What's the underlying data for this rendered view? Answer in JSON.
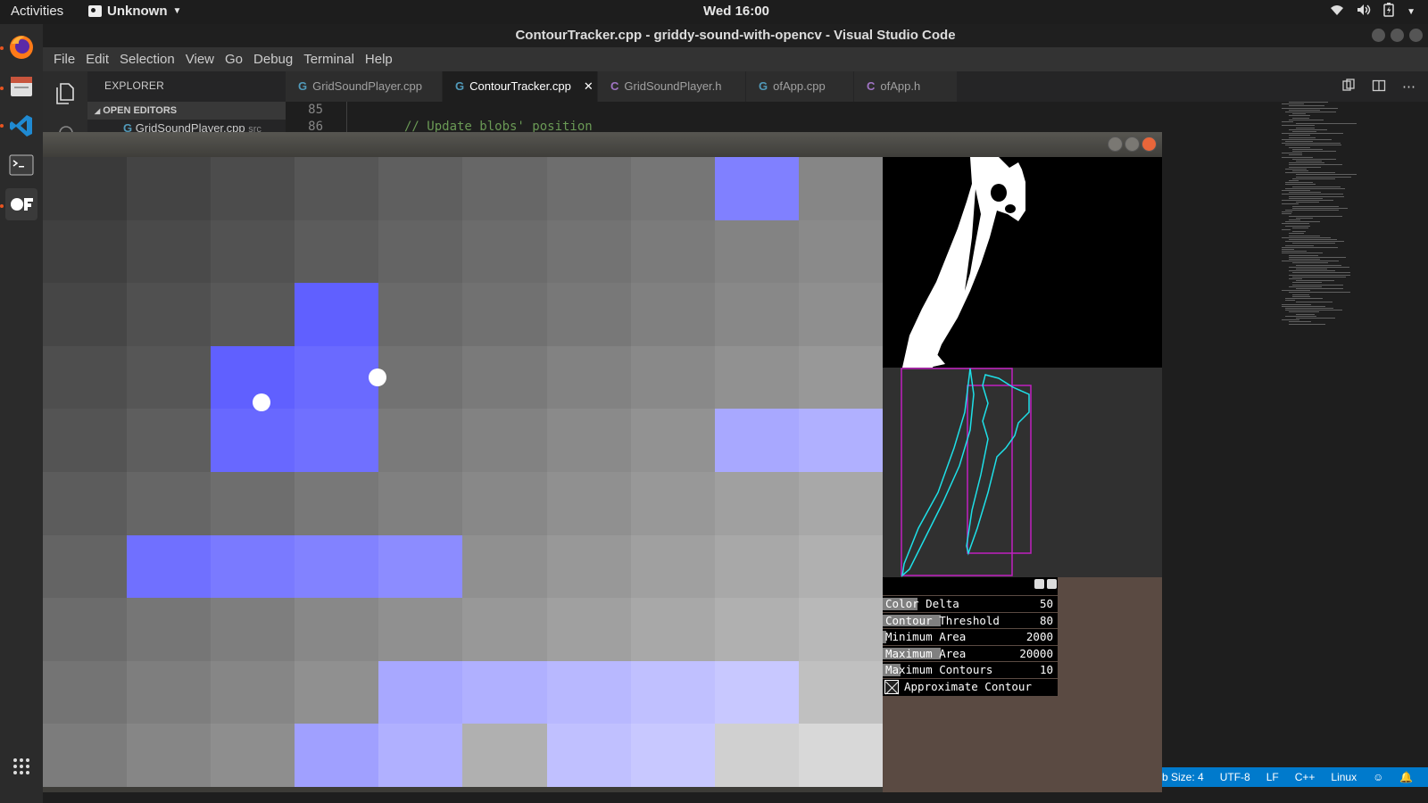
{
  "topbar": {
    "activities": "Activities",
    "app_name": "Unknown",
    "clock": "Wed 16:00"
  },
  "dock": {
    "items": [
      "firefox-icon",
      "files-icon",
      "vscode-icon",
      "terminal-icon",
      "openframeworks-icon",
      "app-grid-icon"
    ]
  },
  "vscode": {
    "title": "ContourTracker.cpp - griddy-sound-with-opencv - Visual Studio Code",
    "menu": [
      "File",
      "Edit",
      "Selection",
      "View",
      "Go",
      "Debug",
      "Terminal",
      "Help"
    ],
    "explorer": {
      "header": "EXPLORER",
      "section": "OPEN EDITORS",
      "item": "GridSoundPlayer.cpp",
      "item_suffix": "src"
    },
    "tabs": [
      {
        "label": "GridSoundPlayer.cpp",
        "icon": "cpp"
      },
      {
        "label": "ContourTracker.cpp",
        "icon": "cpp",
        "active": true
      },
      {
        "label": "GridSoundPlayer.h",
        "icon": "h"
      },
      {
        "label": "ofApp.cpp",
        "icon": "cpp"
      },
      {
        "label": "ofApp.h",
        "icon": "h"
      }
    ],
    "gutter": [
      "85",
      "86"
    ],
    "code_line": "// Update blobs' position",
    "status": {
      "tab_size": "b Size: 4",
      "encoding": "UTF-8",
      "eol": "LF",
      "language": "C++",
      "os": "Linux"
    }
  },
  "of_window": {
    "grid_colors": [
      [
        "#3a3a3a",
        "#444444",
        "#4c4c4c",
        "#565656",
        "#5f5f5f",
        "#676767",
        "#6e6e6e",
        "#767676",
        "#8080ff",
        "#868686"
      ],
      [
        "#404040",
        "#4a4a4a",
        "#525252",
        "#5c5c5c",
        "#646464",
        "#6c6c6c",
        "#737373",
        "#7b7b7b",
        "#838383",
        "#8a8a8a"
      ],
      [
        "#464646",
        "#505050",
        "#585858",
        "#6060ff",
        "#6a6a6a",
        "#717171",
        "#787878",
        "#808080",
        "#888888",
        "#8f8f8f"
      ],
      [
        "#4e4e4e",
        "#565656",
        "#6060ff",
        "#6a6aff",
        "#727272",
        "#7a7a7a",
        "#828282",
        "#898989",
        "#919191",
        "#989898"
      ],
      [
        "#545454",
        "#5e5e5e",
        "#6868ff",
        "#7070ff",
        "#7a7a7a",
        "#828282",
        "#8a8a8a",
        "#929292",
        "#a8a8ff",
        "#b0b0ff"
      ],
      [
        "#5c5c5c",
        "#666666",
        "#6e6e6e",
        "#787878",
        "#808080",
        "#888888",
        "#909090",
        "#989898",
        "#a0a0a0",
        "#a8a8a8"
      ],
      [
        "#646464",
        "#7070ff",
        "#7a7aff",
        "#8282ff",
        "#8c8cff",
        "#909090",
        "#989898",
        "#a0a0a0",
        "#a8a8a8",
        "#b0b0b0"
      ],
      [
        "#6c6c6c",
        "#767676",
        "#7e7e7e",
        "#888888",
        "#909090",
        "#989898",
        "#a0a0a0",
        "#a8a8a8",
        "#b0b0b0",
        "#b8b8b8"
      ],
      [
        "#747474",
        "#7e7e7e",
        "#868686",
        "#909090",
        "#a8a8ff",
        "#b0b0ff",
        "#b8b8ff",
        "#c0c0ff",
        "#c8c8ff",
        "#c0c0c0"
      ],
      [
        "#7c7c7c",
        "#868686",
        "#8e8e8e",
        "#a0a0ff",
        "#b0b0ff",
        "#b0b0b0",
        "#c0c0ff",
        "#c8c8ff",
        "#d0d0d0",
        "#d8d8d8"
      ]
    ],
    "blobs": [
      {
        "col": 2.6,
        "row": 3.9
      },
      {
        "col": 3.98,
        "row": 3.5
      }
    ],
    "gui": {
      "sliders": [
        {
          "label": "Color Delta",
          "value": "50",
          "fraction": 0.2
        },
        {
          "label": "Contour Threshold",
          "value": "80",
          "fraction": 0.33
        },
        {
          "label": "Minimum Area",
          "value": "2000",
          "fraction": 0.02
        },
        {
          "label": "Maximum Area",
          "value": "20000",
          "fraction": 0.33
        },
        {
          "label": "Maximum Contours",
          "value": "10",
          "fraction": 0.1
        }
      ],
      "toggle_label": "Approximate Contour",
      "toggle_checked": true
    }
  }
}
